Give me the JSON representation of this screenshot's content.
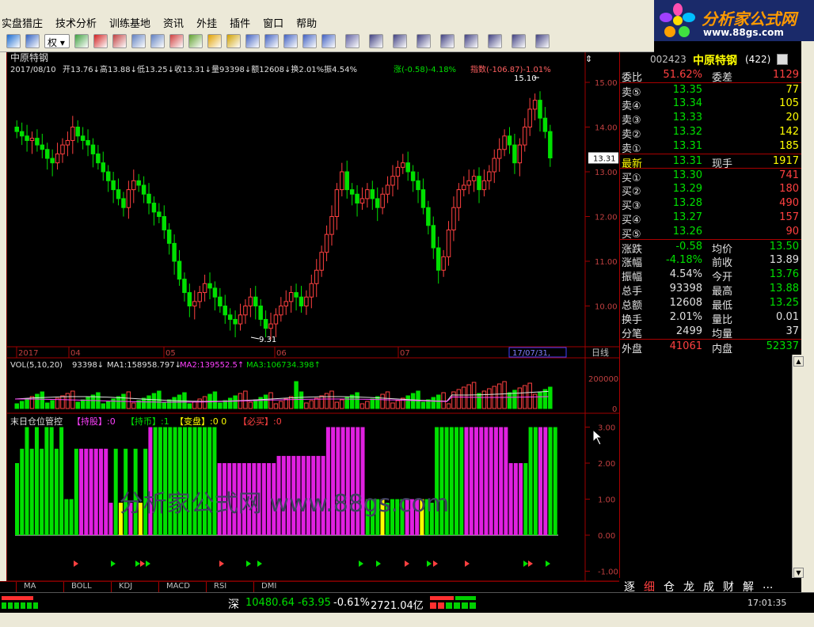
{
  "menu": [
    "实盘猎庄",
    "技术分析",
    "训练基地",
    "资讯",
    "外挂",
    "插件",
    "窗口",
    "帮助"
  ],
  "logo": {
    "line1": "分析家公式网",
    "line2": "www.88gs.com"
  },
  "toolbar_icons": [
    "cross-icon",
    "layout-icon",
    "quan-icon",
    "grid-icon",
    "close-red-icon",
    "bars-icon",
    "doc-icon",
    "doc2-icon",
    "alert-icon",
    "money-icon",
    "warning-icon",
    "gear-icon",
    "chart-icon",
    "table-icon",
    "chart2-icon",
    "chart3-icon",
    "chart4-icon",
    "draw-icon",
    "line-icon",
    "hline-icon",
    "vline-icon",
    "fan-icon",
    "channel-icon",
    "parallel-icon",
    "rect-icon",
    "ellipse-icon"
  ],
  "toolbar_quan": "权",
  "chart": {
    "stock_name": "中原特钢",
    "date": "2017/08/10",
    "quote": "开13.76↓高13.88↓低13.25↓收13.31↓量93398↓额12608↓换2.01%振4.54%",
    "change": "涨(-0.58)-4.18%",
    "index": "指数(-106.87)-1.01%",
    "high_label": "15.10",
    "low_label": "9.31",
    "current_price": "13.31",
    "price_axis": [
      "15.00",
      "14.00",
      "13.00",
      "12.00",
      "11.00",
      "10.00"
    ],
    "date_axis": [
      "2017",
      "04",
      "05",
      "06",
      "07"
    ],
    "date_cursor": "17/07/31,",
    "period": "日线",
    "vol_label": "VOL(5,10,20)",
    "vol_val": "93398↓",
    "ma1": "MA1:158958.797↓",
    "ma2": "MA2:139552.5↑",
    "ma3": "MA3:106734.398↑",
    "vol_axis": [
      "200000",
      "0"
    ],
    "ind_title": "末日仓位管控",
    "ind_c1": "【持股】:0",
    "ind_c2": "【持币】:1",
    "ind_c3": "【变盘】:0 0",
    "ind_c4": "【必买】:0",
    "ind_axis": [
      "3.00",
      "2.00",
      "1.00",
      "0.00",
      "-1.00"
    ],
    "watermark": "分析家公式网 www.88gs.com",
    "tabs": [
      "MA",
      "BOLL",
      "KDJ",
      "MACD",
      "RSI",
      "DMI"
    ]
  },
  "quote_panel": {
    "code": "002423",
    "name": "中原特钢",
    "count": "(422)",
    "rows": [
      {
        "l": "委比",
        "v": "51.62%",
        "l2": "委差",
        "v2": "1129",
        "c": "#ff4040",
        "c2": "#ff4040"
      },
      {
        "l": "卖⑤",
        "v": "13.35",
        "l2": "",
        "v2": "77",
        "c": "#00e000",
        "c2": "#ffff00"
      },
      {
        "l": "卖④",
        "v": "13.34",
        "l2": "",
        "v2": "105",
        "c": "#00e000",
        "c2": "#ffff00"
      },
      {
        "l": "卖③",
        "v": "13.33",
        "l2": "",
        "v2": "20",
        "c": "#00e000",
        "c2": "#ffff00"
      },
      {
        "l": "卖②",
        "v": "13.32",
        "l2": "",
        "v2": "142",
        "c": "#00e000",
        "c2": "#ffff00"
      },
      {
        "l": "卖①",
        "v": "13.31",
        "l2": "",
        "v2": "185",
        "c": "#00e000",
        "c2": "#ffff00"
      },
      {
        "l": "最新",
        "v": "13.31",
        "l2": "现手",
        "v2": "1917",
        "c": "#00e000",
        "c2": "#ffff00"
      },
      {
        "l": "买①",
        "v": "13.30",
        "l2": "",
        "v2": "741",
        "c": "#00e000",
        "c2": "#ff4040"
      },
      {
        "l": "买②",
        "v": "13.29",
        "l2": "",
        "v2": "180",
        "c": "#00e000",
        "c2": "#ff4040"
      },
      {
        "l": "买③",
        "v": "13.28",
        "l2": "",
        "v2": "490",
        "c": "#00e000",
        "c2": "#ff4040"
      },
      {
        "l": "买④",
        "v": "13.27",
        "l2": "",
        "v2": "157",
        "c": "#00e000",
        "c2": "#ff4040"
      },
      {
        "l": "买⑤",
        "v": "13.26",
        "l2": "",
        "v2": "90",
        "c": "#00e000",
        "c2": "#ff4040"
      },
      {
        "l": "涨跌",
        "v": "-0.58",
        "l2": "均价",
        "v2": "13.50",
        "c": "#00e000",
        "c2": "#00e000"
      },
      {
        "l": "涨幅",
        "v": "-4.18%",
        "l2": "前收",
        "v2": "13.89",
        "c": "#00e000",
        "c2": "#e0e0e0"
      },
      {
        "l": "振幅",
        "v": "4.54%",
        "l2": "今开",
        "v2": "13.76",
        "c": "#e0e0e0",
        "c2": "#00e000"
      },
      {
        "l": "总手",
        "v": "93398",
        "l2": "最高",
        "v2": "13.88",
        "c": "#e0e0e0",
        "c2": "#00e000"
      },
      {
        "l": "总额",
        "v": "12608",
        "l2": "最低",
        "v2": "13.25",
        "c": "#e0e0e0",
        "c2": "#00e000"
      },
      {
        "l": "换手",
        "v": "2.01%",
        "l2": "量比",
        "v2": "0.01",
        "c": "#e0e0e0",
        "c2": "#e0e0e0"
      },
      {
        "l": "分笔",
        "v": "2499",
        "l2": "均量",
        "v2": "37",
        "c": "#e0e0e0",
        "c2": "#e0e0e0"
      },
      {
        "l": "外盘",
        "v": "41061",
        "l2": "内盘",
        "v2": "52337",
        "c": "#ff4040",
        "c2": "#00e000"
      }
    ],
    "tabs": [
      "逐",
      "细",
      "仓",
      "龙",
      "成",
      "财",
      "解",
      "..."
    ]
  },
  "status": {
    "market": "深",
    "index": "10480.64",
    "change": "-63.95",
    "pct": "-0.61%",
    "amount": "2721.04亿",
    "time": "17:01:35"
  }
}
